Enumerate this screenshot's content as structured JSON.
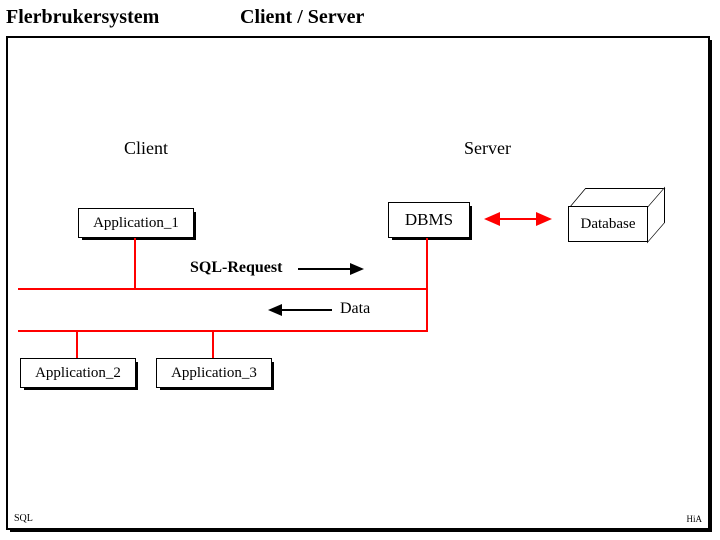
{
  "titles": {
    "left": "Flerbrukersystem",
    "right": "Client / Server"
  },
  "sections": {
    "client": "Client",
    "server": "Server"
  },
  "boxes": {
    "app1": "Application_1",
    "app2": "Application_2",
    "app3": "Application_3",
    "dbms": "DBMS",
    "database": "Database"
  },
  "labels": {
    "sql_request": "SQL-Request",
    "data": "Data"
  },
  "footer": {
    "left": "SQL",
    "right": "HiA"
  },
  "colors": {
    "bus": "#ff0000",
    "frame": "#000000"
  }
}
